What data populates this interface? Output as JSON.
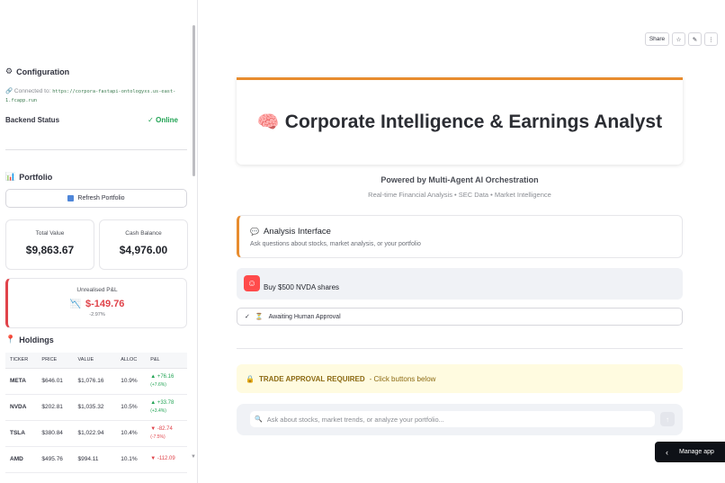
{
  "sidebar": {
    "config": {
      "icon": "gear-icon",
      "heading": "Configuration"
    },
    "connection": {
      "icon": "link-icon",
      "label": "Connected to:",
      "url": "https://corpora-fastapi-ontologyxs.us-east-1.fcapp.run"
    },
    "backend": {
      "label": "Backend Status",
      "status": "✓ Online"
    },
    "portfolio": {
      "icon": "bar-chart-icon",
      "heading": "Portfolio"
    },
    "refresh_button": "Refresh Portfolio",
    "metrics": [
      {
        "label": "Total Value",
        "value": "$9,863.67"
      },
      {
        "label": "Cash Balance",
        "value": "$4,976.00"
      }
    ],
    "pnl": {
      "label": "Unrealised P&L",
      "icon": "chart-down-icon",
      "value": "$-149.76",
      "pct": "-2.97%"
    },
    "holdings": {
      "icon": "pin-icon",
      "heading": "Holdings",
      "columns": [
        "TICKER",
        "PRICE",
        "VALUE",
        "ALLOC",
        "P&L"
      ],
      "rows": [
        {
          "ticker": "META",
          "price": "$646.01",
          "value": "$1,076.16",
          "alloc": "10.9%",
          "pl": "▲ +76.16",
          "pl_pct": "(+7.6%)",
          "dir": "up"
        },
        {
          "ticker": "NVDA",
          "price": "$202.81",
          "value": "$1,035.32",
          "alloc": "10.5%",
          "pl": "▲ +33.78",
          "pl_pct": "(+3.4%)",
          "dir": "up"
        },
        {
          "ticker": "TSLA",
          "price": "$380.84",
          "value": "$1,022.94",
          "alloc": "10.4%",
          "pl": "▼ -82.74",
          "pl_pct": "(-7.5%)",
          "dir": "down"
        },
        {
          "ticker": "AMD",
          "price": "$495.76",
          "value": "$994.11",
          "alloc": "10.1%",
          "pl": "▼ -112.09",
          "pl_pct": "",
          "dir": "down"
        }
      ]
    }
  },
  "toolbar": {
    "share": "Share",
    "star_icon": "star-icon",
    "edit_icon": "pencil-icon",
    "menu_icon": "more-vertical-icon"
  },
  "main": {
    "title_icon": "brain-icon",
    "title": "Corporate Intelligence & Earnings Analyst",
    "powered_by": "Powered by Multi-Agent AI Orchestration",
    "subtitle": "Real-time Financial Analysis • SEC Data • Market Intelligence",
    "analysis": {
      "icon": "speech-bubble-icon",
      "title": "Analysis Interface",
      "subtitle": "Ask questions about stocks, market analysis, or your portfolio"
    },
    "chat_message": {
      "avatar_icon": "bot-avatar-icon",
      "text": "Buy $500 NVDA shares"
    },
    "approval_status": {
      "check": "✓",
      "icon": "hourglass-icon",
      "text": "Awaiting Human Approval"
    },
    "trade_banner": {
      "icon": "lock-icon",
      "bold": "TRADE APPROVAL REQUIRED",
      "rest": " - Click buttons below"
    },
    "chat_input": {
      "placeholder": "Ask about stocks, market trends, or analyze your portfolio...",
      "value": ""
    },
    "manage_app": "Manage app"
  },
  "colors": {
    "accent": "#e88c2e",
    "negative": "#e0434a",
    "positive": "#21a354",
    "banner_bg": "#fffbe0"
  }
}
